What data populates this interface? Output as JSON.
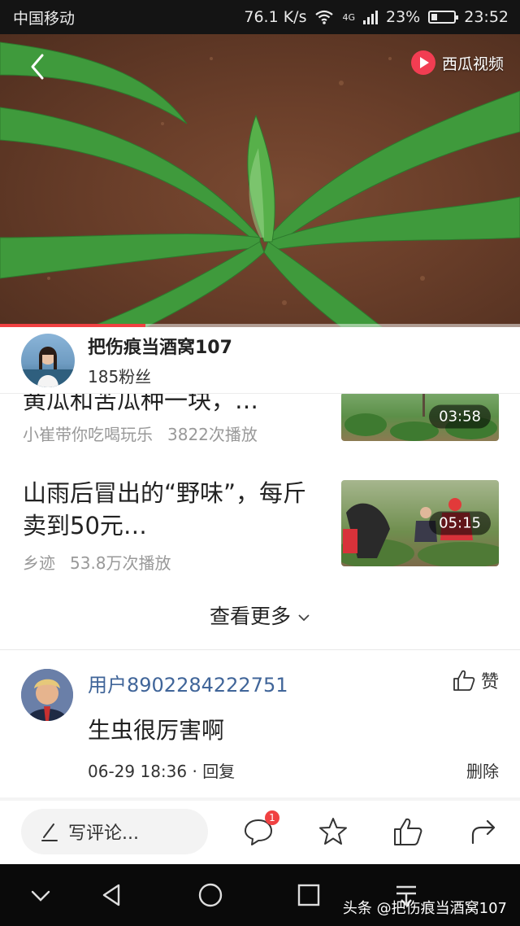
{
  "status_bar": {
    "carrier": "中国移动",
    "speed": "76.1 K/s",
    "network": "4G",
    "battery": "23%",
    "time": "23:52"
  },
  "video": {
    "brand": "西瓜视频",
    "progress_fraction": 0.28,
    "icons": [
      "back-icon",
      "xigua-play-icon"
    ]
  },
  "author": {
    "name": "把伤痕当酒窝107",
    "fans": "185粉丝"
  },
  "related": [
    {
      "title": "黄瓜和苦瓜种一块，…",
      "source": "小崔带你吃喝玩乐",
      "plays": "3822次播放",
      "duration": "03:58"
    },
    {
      "title": "山雨后冒出的“野味”，每斤卖到50元…",
      "source": "乡迹",
      "plays": "53.8万次播放",
      "duration": "05:15"
    }
  ],
  "more_label": "查看更多",
  "comment": {
    "user": "用户8902284222751",
    "like_label": "赞",
    "text": "生虫很厉害啊",
    "time": "06-29 18:36",
    "separator": "·",
    "reply_label": "回复",
    "delete_label": "删除"
  },
  "action_bar": {
    "write_placeholder": "写评论...",
    "comment_badge": "1",
    "icons": [
      "pencil-icon",
      "comment-icon",
      "star-icon",
      "thumb-up-icon",
      "share-icon"
    ]
  },
  "nav_bar": {
    "watermark": "头条 @把伤痕当酒窝107",
    "icons": [
      "collapse-icon",
      "back-triangle-icon",
      "home-circle-icon",
      "recents-square-icon",
      "menu-icon"
    ]
  },
  "colors": {
    "accent_red": "#f04142",
    "username_blue": "#406599",
    "brand_red": "#f23d52"
  }
}
